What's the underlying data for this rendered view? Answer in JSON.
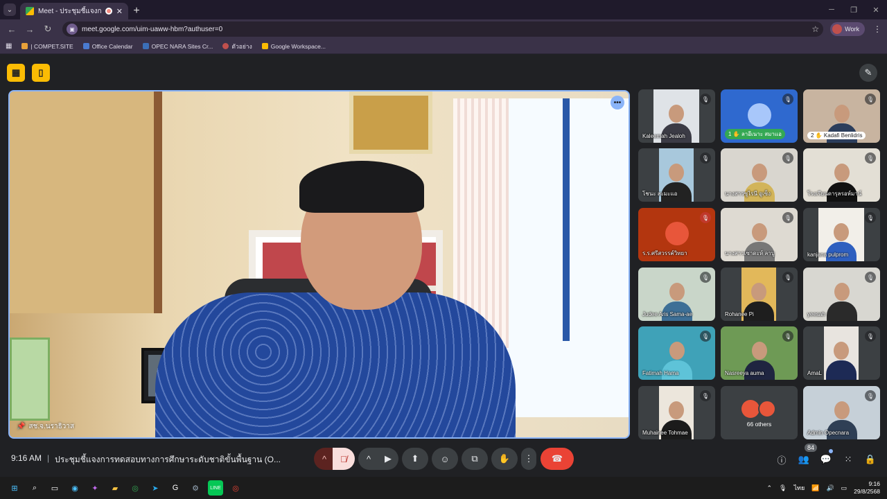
{
  "browser": {
    "tab_title": "Meet - ประชุมชี้แจงการทดสอบ...",
    "new_tab": "+",
    "url": "meet.google.com/uim-uaww-hbm?authuser=0",
    "profile": "Work",
    "bookmarks": [
      "| COMPET.SITE",
      "Office Calendar",
      "OPEC NARA Sites Cr...",
      "ตัวอย่าง",
      "Google Workspace..."
    ]
  },
  "main_video": {
    "name": "สช.จ.นราธิวาส"
  },
  "tiles": [
    {
      "name": "Kaleemah Jealoh"
    },
    {
      "name": "ลาอีเนาะ สมาแอ",
      "badge": "1"
    },
    {
      "name": "Kadafi Benlidris",
      "badge": "2"
    },
    {
      "name": "โชนะ สะมะแอ"
    },
    {
      "name": "นางสาวซูไรนี อูเซ็ง"
    },
    {
      "name": "โรงเรียนดารุลรอห์มาน์"
    },
    {
      "name": "ร.ร.ศรีสวรรค์วิทยา"
    },
    {
      "name": "นางสาวเซาดะห์ ลาบู"
    },
    {
      "name": "kanjana pulprom"
    },
    {
      "name": "Judee Aris Sama-ae"
    },
    {
      "name": "Rohanee Pi"
    },
    {
      "name": "yeesah"
    },
    {
      "name": "Fatimah Hama"
    },
    {
      "name": "Nasreeya auma"
    },
    {
      "name": "AmaL"
    },
    {
      "name": "Muhainee Tohmae"
    },
    {
      "name": "66 others"
    },
    {
      "name": "Admin Opecnara"
    }
  ],
  "bottom_bar": {
    "time": "9:16 AM",
    "separator": "|",
    "meeting_title": "ประชุมชี้แจงการทดสอบทางการศึกษาระดับชาติขั้นพื้นฐาน (O...",
    "people_count": "84"
  },
  "taskbar": {
    "time": "9:16",
    "date": "29/8/2568",
    "lang": "ไทย"
  },
  "colors": {
    "accent_blue": "#8ab4f8",
    "end_call_red": "#ea4335",
    "reaction_yellow": "#fbbc04"
  }
}
